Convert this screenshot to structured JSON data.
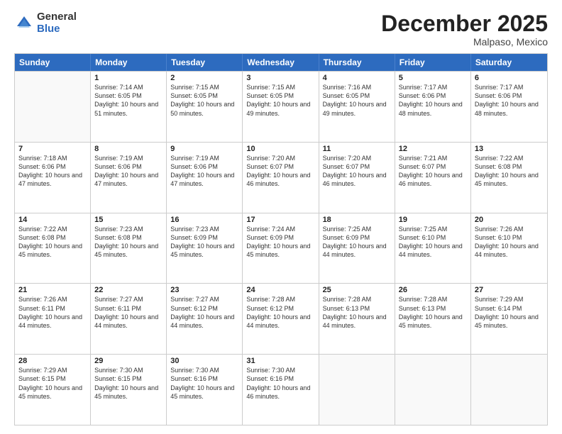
{
  "logo": {
    "general": "General",
    "blue": "Blue"
  },
  "header": {
    "month": "December 2025",
    "location": "Malpaso, Mexico"
  },
  "weekdays": [
    "Sunday",
    "Monday",
    "Tuesday",
    "Wednesday",
    "Thursday",
    "Friday",
    "Saturday"
  ],
  "weeks": [
    [
      {
        "day": "",
        "empty": true
      },
      {
        "day": "1",
        "sunrise": "7:14 AM",
        "sunset": "6:05 PM",
        "daylight": "10 hours and 51 minutes."
      },
      {
        "day": "2",
        "sunrise": "7:15 AM",
        "sunset": "6:05 PM",
        "daylight": "10 hours and 50 minutes."
      },
      {
        "day": "3",
        "sunrise": "7:15 AM",
        "sunset": "6:05 PM",
        "daylight": "10 hours and 49 minutes."
      },
      {
        "day": "4",
        "sunrise": "7:16 AM",
        "sunset": "6:05 PM",
        "daylight": "10 hours and 49 minutes."
      },
      {
        "day": "5",
        "sunrise": "7:17 AM",
        "sunset": "6:06 PM",
        "daylight": "10 hours and 48 minutes."
      },
      {
        "day": "6",
        "sunrise": "7:17 AM",
        "sunset": "6:06 PM",
        "daylight": "10 hours and 48 minutes."
      }
    ],
    [
      {
        "day": "7",
        "sunrise": "7:18 AM",
        "sunset": "6:06 PM",
        "daylight": "10 hours and 47 minutes."
      },
      {
        "day": "8",
        "sunrise": "7:19 AM",
        "sunset": "6:06 PM",
        "daylight": "10 hours and 47 minutes."
      },
      {
        "day": "9",
        "sunrise": "7:19 AM",
        "sunset": "6:06 PM",
        "daylight": "10 hours and 47 minutes."
      },
      {
        "day": "10",
        "sunrise": "7:20 AM",
        "sunset": "6:07 PM",
        "daylight": "10 hours and 46 minutes."
      },
      {
        "day": "11",
        "sunrise": "7:20 AM",
        "sunset": "6:07 PM",
        "daylight": "10 hours and 46 minutes."
      },
      {
        "day": "12",
        "sunrise": "7:21 AM",
        "sunset": "6:07 PM",
        "daylight": "10 hours and 46 minutes."
      },
      {
        "day": "13",
        "sunrise": "7:22 AM",
        "sunset": "6:08 PM",
        "daylight": "10 hours and 45 minutes."
      }
    ],
    [
      {
        "day": "14",
        "sunrise": "7:22 AM",
        "sunset": "6:08 PM",
        "daylight": "10 hours and 45 minutes."
      },
      {
        "day": "15",
        "sunrise": "7:23 AM",
        "sunset": "6:08 PM",
        "daylight": "10 hours and 45 minutes."
      },
      {
        "day": "16",
        "sunrise": "7:23 AM",
        "sunset": "6:09 PM",
        "daylight": "10 hours and 45 minutes."
      },
      {
        "day": "17",
        "sunrise": "7:24 AM",
        "sunset": "6:09 PM",
        "daylight": "10 hours and 45 minutes."
      },
      {
        "day": "18",
        "sunrise": "7:25 AM",
        "sunset": "6:09 PM",
        "daylight": "10 hours and 44 minutes."
      },
      {
        "day": "19",
        "sunrise": "7:25 AM",
        "sunset": "6:10 PM",
        "daylight": "10 hours and 44 minutes."
      },
      {
        "day": "20",
        "sunrise": "7:26 AM",
        "sunset": "6:10 PM",
        "daylight": "10 hours and 44 minutes."
      }
    ],
    [
      {
        "day": "21",
        "sunrise": "7:26 AM",
        "sunset": "6:11 PM",
        "daylight": "10 hours and 44 minutes."
      },
      {
        "day": "22",
        "sunrise": "7:27 AM",
        "sunset": "6:11 PM",
        "daylight": "10 hours and 44 minutes."
      },
      {
        "day": "23",
        "sunrise": "7:27 AM",
        "sunset": "6:12 PM",
        "daylight": "10 hours and 44 minutes."
      },
      {
        "day": "24",
        "sunrise": "7:28 AM",
        "sunset": "6:12 PM",
        "daylight": "10 hours and 44 minutes."
      },
      {
        "day": "25",
        "sunrise": "7:28 AM",
        "sunset": "6:13 PM",
        "daylight": "10 hours and 44 minutes."
      },
      {
        "day": "26",
        "sunrise": "7:28 AM",
        "sunset": "6:13 PM",
        "daylight": "10 hours and 45 minutes."
      },
      {
        "day": "27",
        "sunrise": "7:29 AM",
        "sunset": "6:14 PM",
        "daylight": "10 hours and 45 minutes."
      }
    ],
    [
      {
        "day": "28",
        "sunrise": "7:29 AM",
        "sunset": "6:15 PM",
        "daylight": "10 hours and 45 minutes."
      },
      {
        "day": "29",
        "sunrise": "7:30 AM",
        "sunset": "6:15 PM",
        "daylight": "10 hours and 45 minutes."
      },
      {
        "day": "30",
        "sunrise": "7:30 AM",
        "sunset": "6:16 PM",
        "daylight": "10 hours and 45 minutes."
      },
      {
        "day": "31",
        "sunrise": "7:30 AM",
        "sunset": "6:16 PM",
        "daylight": "10 hours and 46 minutes."
      },
      {
        "day": "",
        "empty": true
      },
      {
        "day": "",
        "empty": true
      },
      {
        "day": "",
        "empty": true
      }
    ]
  ],
  "labels": {
    "sunrise": "Sunrise:",
    "sunset": "Sunset:",
    "daylight": "Daylight:"
  }
}
